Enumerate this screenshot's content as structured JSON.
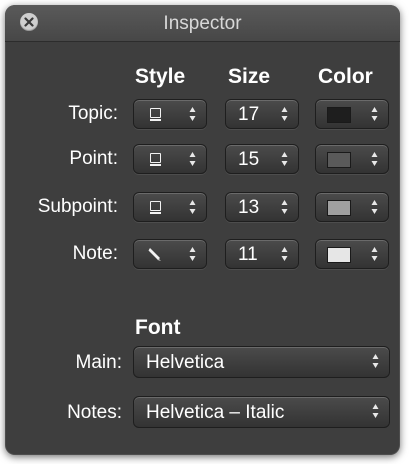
{
  "window": {
    "title": "Inspector"
  },
  "columns": {
    "style": "Style",
    "size": "Size",
    "color": "Color"
  },
  "rows": [
    {
      "label": "Topic:",
      "style_icon": "document-icon",
      "size": "17",
      "color": "#1e1e1e"
    },
    {
      "label": "Point:",
      "style_icon": "document-icon",
      "size": "15",
      "color": "#5a5a5a"
    },
    {
      "label": "Subpoint:",
      "style_icon": "document-icon",
      "size": "13",
      "color": "#a0a0a0"
    },
    {
      "label": "Note:",
      "style_icon": "pencil-icon",
      "size": "11",
      "color": "#e6e6e6"
    }
  ],
  "font": {
    "heading": "Font",
    "main_label": "Main:",
    "main_value": "Helvetica",
    "notes_label": "Notes:",
    "notes_value": "Helvetica – Italic"
  }
}
